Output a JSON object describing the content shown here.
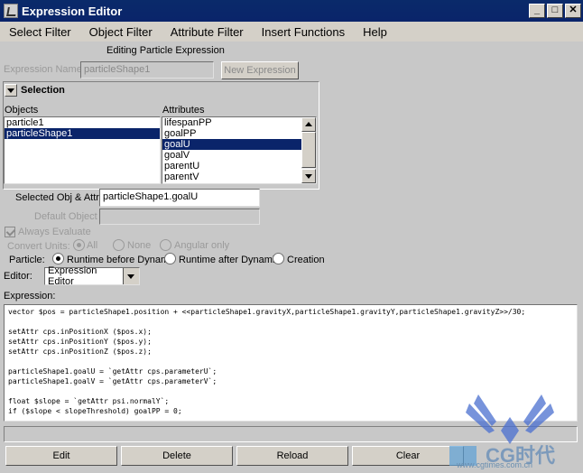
{
  "window": {
    "title": "Expression Editor"
  },
  "menu": [
    "Select Filter",
    "Object Filter",
    "Attribute Filter",
    "Insert Functions",
    "Help"
  ],
  "heading": "Editing Particle Expression",
  "expression_name": {
    "label": "Expression Name",
    "value": "particleShape1",
    "new_button": "New Expression"
  },
  "selection": {
    "title": "Selection",
    "objects_label": "Objects",
    "attributes_label": "Attributes",
    "objects": [
      "particle1",
      "particleShape1"
    ],
    "attributes": [
      "lifespanPP",
      "goalPP",
      "goalU",
      "goalV",
      "parentU",
      "parentV"
    ]
  },
  "selected_obj_attr": {
    "label": "Selected Obj & Attr",
    "value": "particleShape1.goalU"
  },
  "default_object": {
    "label": "Default Object",
    "value": ""
  },
  "always_evaluate": "Always Evaluate",
  "convert_units": {
    "label": "Convert Units:",
    "options": [
      "All",
      "None",
      "Angular only"
    ]
  },
  "particle": {
    "label": "Particle:",
    "options": [
      "Runtime before Dynami",
      "Runtime after Dynamic",
      "Creation"
    ]
  },
  "editor": {
    "label": "Editor:",
    "value": "Expression Editor"
  },
  "expression_label": "Expression:",
  "code": "vector $pos = particleShape1.position + <<particleShape1.gravityX,particleShape1.gravityY,particleShape1.gravityZ>>/30;\n\nsetAttr cps.inPositionX ($pos.x);\nsetAttr cps.inPositionY ($pos.y);\nsetAttr cps.inPositionZ ($pos.z);\n\nparticleShape1.goalU = `getAttr cps.parameterU`;\nparticleShape1.goalV = `getAttr cps.parameterV`;\n\nfloat $slope = `getAttr psi.normalY`;\nif ($slope < slopeThreshold) goalPP = 0;",
  "buttons": [
    "Edit",
    "Delete",
    "Reload",
    "Clear"
  ],
  "watermark": {
    "brand": "CG时代",
    "url": "www.cgtimes.com.cn"
  }
}
